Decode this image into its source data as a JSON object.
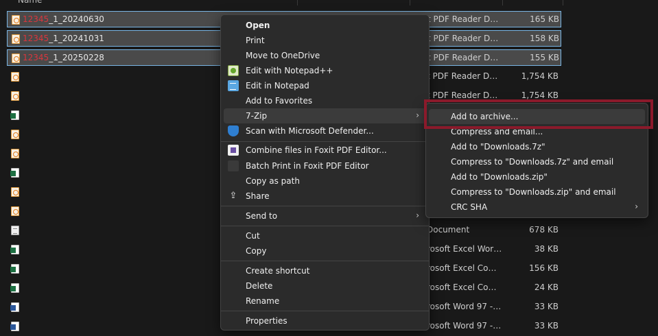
{
  "files": [
    {
      "icon": "pdf-icon",
      "name_redacted": "12345",
      "name_rest": "_1_20240630",
      "type": "t PDF Reader Doc...",
      "size": "165 KB",
      "selected": true
    },
    {
      "icon": "pdf-icon",
      "name_redacted": "12345",
      "name_rest": "_1_20241031",
      "type": "t PDF Reader Doc...",
      "size": "158 KB",
      "selected": true
    },
    {
      "icon": "pdf-icon",
      "name_redacted": "12345",
      "name_rest": "_1_20250228",
      "type": "t PDF Reader Doc...",
      "size": "155 KB",
      "selected": true
    },
    {
      "icon": "pdf-icon",
      "type": "t PDF Reader Doc...",
      "size": "1,754 KB"
    },
    {
      "icon": "pdf-icon",
      "type": "t PDF Reader Doc...",
      "size": "1,754 KB"
    },
    {
      "icon": "excel-icon",
      "type": "",
      "size": ""
    },
    {
      "icon": "pdf-icon",
      "type": "",
      "size": ""
    },
    {
      "icon": "pdf-icon",
      "type": "",
      "size": ""
    },
    {
      "icon": "excel-icon",
      "type": "",
      "size": ""
    },
    {
      "icon": "pdf-icon",
      "type": "",
      "size": ""
    },
    {
      "icon": "pdf-icon",
      "type": "",
      "size": ""
    },
    {
      "icon": "text-file-icon",
      "type": "Document",
      "size": "678 KB"
    },
    {
      "icon": "excel-icon",
      "type": "rosoft Excel Work...",
      "size": "38 KB"
    },
    {
      "icon": "excel-icon",
      "type": "rosoft Excel Com...",
      "size": "156 KB"
    },
    {
      "icon": "excel-icon",
      "type": "rosoft Excel Com...",
      "size": "24 KB"
    },
    {
      "icon": "word-icon",
      "type": "rosoft Word 97 - ...",
      "size": "33 KB"
    },
    {
      "icon": "word-icon",
      "type": "rosoft Word 97 - ...",
      "size": "33 KB"
    }
  ],
  "context_menu": {
    "open": "Open",
    "print": "Print",
    "move_to_onedrive": "Move to OneDrive",
    "edit_notepadpp": "Edit with Notepad++",
    "edit_notepad": "Edit in Notepad",
    "add_favorites": "Add to Favorites",
    "seven_zip": "7-Zip",
    "scan_defender": "Scan with Microsoft Defender...",
    "combine_foxit": "Combine files in Foxit PDF Editor...",
    "batch_print_foxit": "Batch Print in Foxit PDF Editor",
    "copy_as_path": "Copy as path",
    "share": "Share",
    "send_to": "Send to",
    "cut": "Cut",
    "copy": "Copy",
    "create_shortcut": "Create shortcut",
    "delete": "Delete",
    "rename": "Rename",
    "properties": "Properties"
  },
  "submenu_7zip": {
    "add_to_archive": "Add to archive...",
    "compress_and_email": "Compress and email...",
    "add_to_downloads_7z": "Add to \"Downloads.7z\"",
    "compress_downloads_7z_email": "Compress to \"Downloads.7z\" and email",
    "add_to_downloads_zip": "Add to \"Downloads.zip\"",
    "compress_downloads_zip_email": "Compress to \"Downloads.zip\" and email",
    "crc_sha": "CRC SHA"
  },
  "chevron_glyph": "›",
  "share_glyph": "⇪",
  "colors": {
    "highlight": "#8b1a2b",
    "selection_border": "#7ab6e5",
    "redacted_text": "#d9363e"
  }
}
